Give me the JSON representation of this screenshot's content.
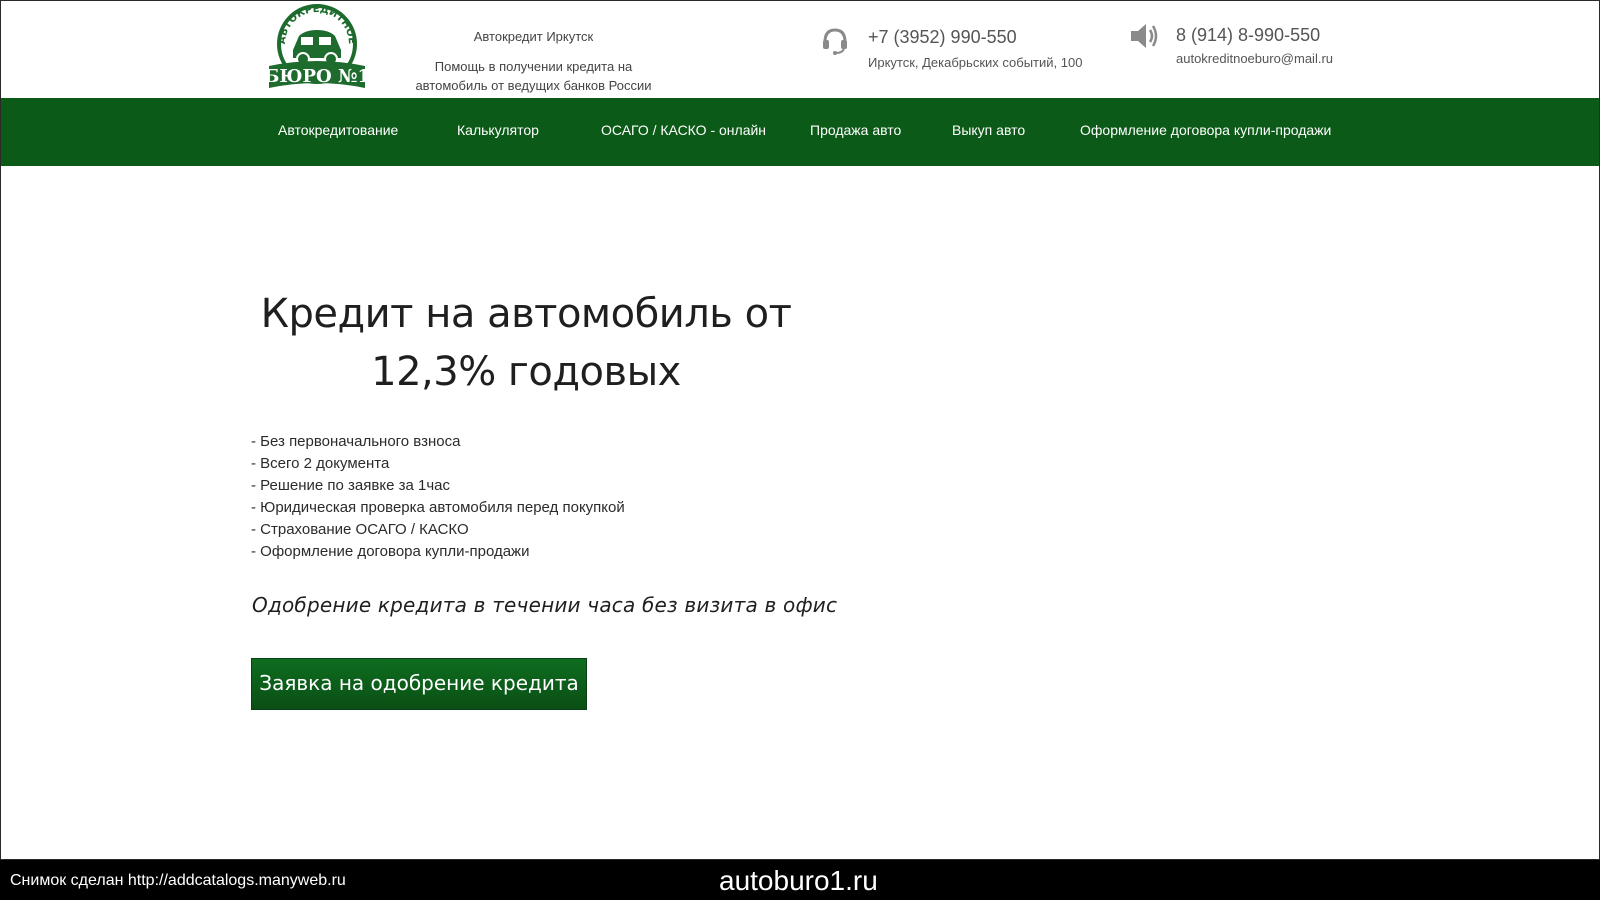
{
  "header": {
    "logo": {
      "top_text": "АВТОКРЕДИТНОЕ",
      "main_text": "БЮРО №1"
    },
    "tagline_city": "Автокредит Иркутск",
    "tagline_desc": "Помощь в получении кредита на автомобиль от ведущих банков России",
    "contact1": {
      "icon": "headset-icon",
      "phone": "+7 (3952) 990-550",
      "address": "Иркутск, Декабрьских событий, 100"
    },
    "contact2": {
      "icon": "speaker-icon",
      "phone": "8 (914) 8-990-550",
      "email": "autokreditnoeburo@mail.ru"
    }
  },
  "nav": {
    "items": [
      {
        "label": "Автокредитование"
      },
      {
        "label": "Калькулятор"
      },
      {
        "label": "ОСАГО / КАСКО - онлайн"
      },
      {
        "label": "Продажа авто"
      },
      {
        "label": "Выкуп авто"
      },
      {
        "label": "Оформление договора купли-продажи"
      }
    ]
  },
  "hero": {
    "title_line1": "Кредит на автомобиль от",
    "title_line2": "12,3% годовых",
    "features": [
      "- Без первоначального взноса",
      "- Всего 2 документа",
      "- Решение по заявке за 1час",
      "- Юридическая проверка автомобиля перед покупкой",
      "- Страхование ОСАГО / КАСКО",
      "- Оформление договора купли-продажи"
    ],
    "approval_text": "Одобрение кредита в течении часа без визита в офис",
    "cta_label": "Заявка на одобрение кредита"
  },
  "footer_bar": {
    "snapshot_note": "Снимок сделан http://addcatalogs.manyweb.ru",
    "domain": "autoburo1.ru"
  },
  "colors": {
    "nav_bg": "#0b5a17",
    "cta_bg": "#0e6d1f",
    "logo_green": "#1e6b2e"
  }
}
